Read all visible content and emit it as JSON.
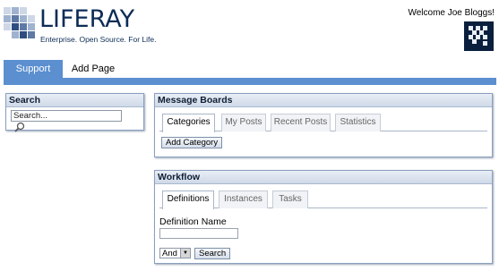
{
  "header": {
    "logo_text": "LIFERAY",
    "logo_tagline": "Enterprise. Open Source. For Life.",
    "welcome": "Welcome Joe Bloggs!"
  },
  "nav": {
    "tabs": [
      {
        "label": "Support",
        "active": true
      },
      {
        "label": "Add Page",
        "active": false
      }
    ]
  },
  "search_portlet": {
    "title": "Search",
    "input_value": "Search...",
    "icon": "search-icon"
  },
  "message_boards": {
    "title": "Message Boards",
    "tabs": [
      {
        "label": "Categories",
        "active": true
      },
      {
        "label": "My Posts",
        "active": false
      },
      {
        "label": "Recent Posts",
        "active": false
      },
      {
        "label": "Statistics",
        "active": false
      }
    ],
    "add_button": "Add Category"
  },
  "workflow": {
    "title": "Workflow",
    "tabs": [
      {
        "label": "Definitions",
        "active": true
      },
      {
        "label": "Instances",
        "active": false
      },
      {
        "label": "Tasks",
        "active": false
      }
    ],
    "definition_label": "Definition Name",
    "definition_value": "",
    "operator_select": "And",
    "search_button": "Search"
  },
  "colors": {
    "nav_blue": "#5b8fd0",
    "logo_navy": "#0d2c57"
  }
}
